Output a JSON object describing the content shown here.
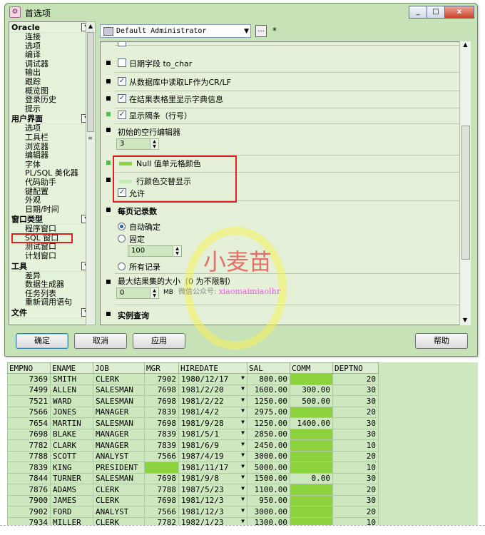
{
  "window": {
    "title": "首选项",
    "buttons": [
      "_",
      "□",
      "x"
    ]
  },
  "left_panel": {
    "categories": [
      {
        "label": "Oracle",
        "items": [
          "连接",
          "选项",
          "编译",
          "调试器",
          "输出",
          "跟踪",
          "概览图",
          "登录历史",
          "提示"
        ]
      },
      {
        "label": "用户界面",
        "items": [
          "选项",
          "工具栏",
          "浏览器",
          "编辑器",
          "字体",
          "PL/SQL 美化器",
          "代码助手",
          "键配置",
          "外观",
          "日期/时间"
        ]
      },
      {
        "label": "窗口类型",
        "items": [
          "程序窗口",
          "SQL 窗口",
          "测试窗口",
          "计划窗口"
        ]
      },
      {
        "label": "工具",
        "items": [
          "差异",
          "数据生成器",
          "任务列表",
          "重新调用语句"
        ]
      },
      {
        "label": "文件",
        "items": []
      }
    ],
    "selected_item": "SQL 窗口"
  },
  "profile": {
    "value": "Default Administrator",
    "more_label": "...",
    "modified_mark": "*"
  },
  "settings": {
    "date_field": "日期字段 to_char",
    "read_lf": "从数据库中读取LF作为CR/LF",
    "show_dict": "在结果表格里显示字典信息",
    "show_gutter": "显示隔条（行号）",
    "init_empty_rows_label": "初始的空行编辑器",
    "init_empty_rows_value": "3",
    "null_color_label": "Null 值单元格颜色",
    "null_color": "#8cd23c",
    "alt_row_label": "行颜色交替显示",
    "alt_row_color": "#c9e8b8",
    "allow_label": "允许",
    "per_page_title": "每页记录数",
    "auto_label": "自动确定",
    "fixed_label": "固定",
    "fixed_value": "100",
    "all_label": "所有记录",
    "max_result_label": "最大结果集的大小（0 为不限制）",
    "max_result_value": "0",
    "max_result_unit": "MB",
    "instance_title": "实例查询"
  },
  "buttons": {
    "ok": "确定",
    "cancel": "取消",
    "apply": "应用",
    "help": "帮助"
  },
  "watermark": {
    "title": "小麦苗",
    "wechat": "微信公众号:",
    "url": "xiaomaimiaolhr"
  },
  "grid": {
    "columns": [
      "EMPNO",
      "ENAME",
      "JOB",
      "MGR",
      "HIREDATE",
      "SAL",
      "COMM",
      "DEPTNO"
    ],
    "rows": [
      [
        "7369",
        "SMITH",
        "CLERK",
        "7902",
        "1980/12/17",
        "800.00",
        "",
        "20"
      ],
      [
        "7499",
        "ALLEN",
        "SALESMAN",
        "7698",
        "1981/2/20",
        "1600.00",
        "300.00",
        "30"
      ],
      [
        "7521",
        "WARD",
        "SALESMAN",
        "7698",
        "1981/2/22",
        "1250.00",
        "500.00",
        "30"
      ],
      [
        "7566",
        "JONES",
        "MANAGER",
        "7839",
        "1981/4/2",
        "2975.00",
        "",
        "20"
      ],
      [
        "7654",
        "MARTIN",
        "SALESMAN",
        "7698",
        "1981/9/28",
        "1250.00",
        "1400.00",
        "30"
      ],
      [
        "7698",
        "BLAKE",
        "MANAGER",
        "7839",
        "1981/5/1",
        "2850.00",
        "",
        "30"
      ],
      [
        "7782",
        "CLARK",
        "MANAGER",
        "7839",
        "1981/6/9",
        "2450.00",
        "",
        "10"
      ],
      [
        "7788",
        "SCOTT",
        "ANALYST",
        "7566",
        "1987/4/19",
        "3000.00",
        "",
        "20"
      ],
      [
        "7839",
        "KING",
        "PRESIDENT",
        "",
        "1981/11/17",
        "5000.00",
        "",
        "10"
      ],
      [
        "7844",
        "TURNER",
        "SALESMAN",
        "7698",
        "1981/9/8",
        "1500.00",
        "0.00",
        "30"
      ],
      [
        "7876",
        "ADAMS",
        "CLERK",
        "7788",
        "1987/5/23",
        "1100.00",
        "",
        "20"
      ],
      [
        "7900",
        "JAMES",
        "CLERK",
        "7698",
        "1981/12/3",
        "950.00",
        "",
        "30"
      ],
      [
        "7902",
        "FORD",
        "ANALYST",
        "7566",
        "1981/12/3",
        "3000.00",
        "",
        "20"
      ],
      [
        "7934",
        "MILLER",
        "CLERK",
        "7782",
        "1982/1/23",
        "1300.00",
        "",
        "10"
      ]
    ]
  }
}
